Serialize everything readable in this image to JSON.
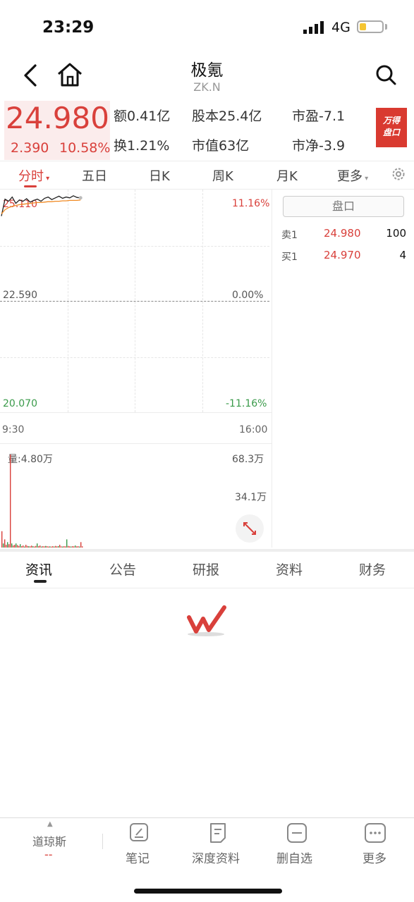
{
  "status_bar": {
    "time": "23:29",
    "network": "4G"
  },
  "header": {
    "stock_name": "极氪",
    "stock_code": "ZK.N"
  },
  "quote": {
    "price": "24.980",
    "change": "2.390",
    "change_pct": "10.58%",
    "stats": [
      {
        "label": "额",
        "value": "0.41亿"
      },
      {
        "label": "股本",
        "value": "25.4亿"
      },
      {
        "label": "市盈",
        "value": "-7.1"
      },
      {
        "label": "换",
        "value": "1.21%"
      },
      {
        "label": "市值",
        "value": "63亿"
      },
      {
        "label": "市净",
        "value": "-3.9"
      }
    ],
    "badge_line1": "万得",
    "badge_line2": "盘口"
  },
  "chart_tabs": [
    "分时",
    "五日",
    "日K",
    "周K",
    "月K",
    "更多"
  ],
  "chart": {
    "top_price": "25.110",
    "top_pct": "11.16%",
    "mid_price": "22.590",
    "mid_pct": "0.00%",
    "bottom_price": "20.070",
    "bottom_pct": "-11.16%",
    "time_start": "9:30",
    "time_end": "16:00",
    "volume_label": "量:4.80万",
    "vol_max": "68.3万",
    "vol_mid": "34.1万"
  },
  "chart_data": {
    "type": "line",
    "x": [
      "9:30",
      "16:00"
    ],
    "ylim": [
      20.07,
      25.11
    ],
    "yticks": [
      "25.110",
      "22.590",
      "20.070"
    ],
    "pct_ticks": [
      "11.16%",
      "0.00%",
      "-11.16%"
    ],
    "series": [
      {
        "values": [
          24.55,
          24.95,
          24.9,
          25.0,
          24.85,
          24.93,
          24.9,
          24.96,
          24.88,
          24.92,
          24.95,
          24.9,
          24.97,
          25.0,
          24.94,
          24.98,
          25.02,
          24.97,
          25.0,
          24.98,
          25.03,
          24.99,
          24.98
        ]
      },
      {
        "values": [
          24.6,
          24.7,
          24.75,
          24.78,
          24.8,
          24.82,
          24.83,
          24.84,
          24.85,
          24.86,
          24.87,
          24.87,
          24.88,
          24.89,
          24.89,
          24.9,
          24.9,
          24.91,
          24.91,
          24.92,
          24.92,
          24.92,
          24.93
        ]
      }
    ],
    "volume": {
      "ylim": [
        0,
        683000
      ],
      "values": [
        120000,
        30000,
        60000,
        20000,
        40000,
        25000,
        683000,
        30000,
        15000,
        20000,
        30000,
        18000,
        12000,
        25000,
        10000,
        15000,
        8000,
        20000,
        12000,
        10000,
        9000,
        14000,
        10000,
        8000,
        12000,
        30000,
        10000,
        15000,
        8000,
        10000,
        9000,
        12000,
        10000,
        8000,
        9000,
        7000,
        10000,
        8000,
        12000,
        9000,
        11000,
        20000,
        9000,
        8000,
        10000,
        9000,
        60000,
        12000,
        9000,
        8000,
        10000,
        9000,
        15000,
        9000,
        10000,
        8000,
        40000,
        9000
      ]
    }
  },
  "orderbook": {
    "title": "盘口",
    "rows": [
      {
        "label": "卖1",
        "price": "24.980",
        "volume": "100"
      },
      {
        "label": "买1",
        "price": "24.970",
        "volume": "4"
      }
    ]
  },
  "info_tabs": [
    "资讯",
    "公告",
    "研报",
    "资料",
    "财务"
  ],
  "bottom_bar": {
    "index_name": "道琼斯",
    "index_value": "--",
    "items": [
      "笔记",
      "深度资料",
      "删自选",
      "更多"
    ]
  },
  "colors": {
    "up": "#d9403b",
    "down": "#3a9a4a",
    "accent": "#d9403b"
  }
}
